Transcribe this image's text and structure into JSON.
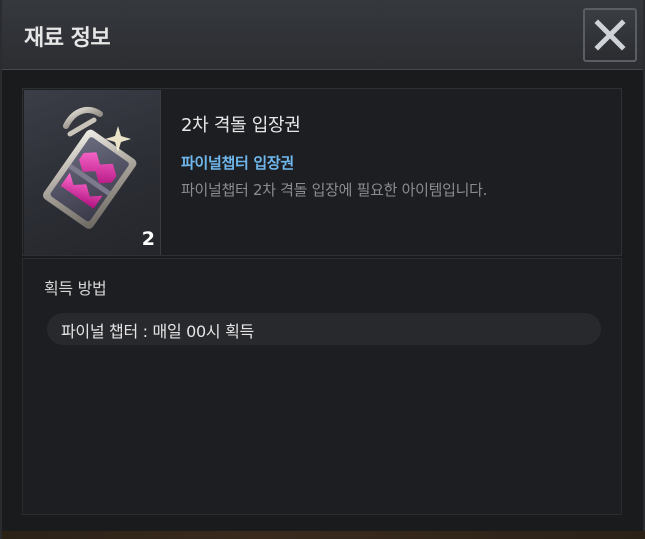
{
  "window": {
    "title": "재료 정보",
    "close_icon": "close-x-icon"
  },
  "item": {
    "icon": "ticket-icon",
    "count": "2",
    "name": "2차 격돌 입장권",
    "category": "파이널챕터 입장권",
    "description": "파이널챕터 2차 격돌 입장에 필요한 아이템입니다.",
    "colors": {
      "category": "#6fb8ee",
      "ticket_accent": "#d8269a"
    }
  },
  "acquisition": {
    "heading": "획득 방법",
    "methods": [
      {
        "text": "파이널 챕터 : 매일 00시 획득"
      }
    ]
  }
}
